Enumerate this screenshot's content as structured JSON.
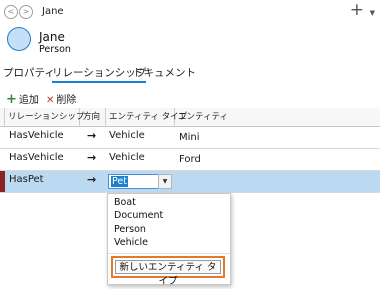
{
  "header": {
    "back_icon": "arrow-left-icon",
    "forward_icon": "arrow-right-icon",
    "back_glyph": "<",
    "forward_glyph": ">",
    "title": "Jane",
    "add_glyph": "+",
    "menu_glyph": "▼"
  },
  "entity": {
    "name": "Jane",
    "type": "Person",
    "avatar_color": "#c5e0f6",
    "avatar_border": "#1f7fcf"
  },
  "tabs": [
    {
      "label": "プロパティ",
      "active": false
    },
    {
      "label": "リレーションシップ",
      "active": true
    },
    {
      "label": "ドキュメント",
      "active": false
    }
  ],
  "toolbar": {
    "add_glyph": "+",
    "add_label": "追加",
    "delete_glyph": "✕",
    "delete_label": "削除"
  },
  "table": {
    "columns": [
      "リレーションシップ",
      "方向",
      "エンティティ タイプ",
      "エンティティ"
    ],
    "rows": [
      {
        "relationship": "HasVehicle",
        "direction": "→",
        "entity_type": "Vehicle",
        "entity": "Mini"
      },
      {
        "relationship": "HasVehicle",
        "direction": "→",
        "entity_type": "Vehicle",
        "entity": "Ford"
      },
      {
        "relationship": "HasPet",
        "direction": "→",
        "entity_type": "Pet",
        "entity": ""
      }
    ],
    "selected_row": 2
  },
  "dropdown": {
    "options": [
      "Boat",
      "Document",
      "Person",
      "Vehicle"
    ],
    "new_button_label": "新しいエンティティ タイプ",
    "highlight_color": "#e07a2e"
  },
  "colors": {
    "accent": "#1f7fcf",
    "selected_row": "#bcd9f2",
    "row_marker": "#8b2323",
    "add_icon": "#2e8b2e",
    "delete_icon": "#c0392b"
  }
}
